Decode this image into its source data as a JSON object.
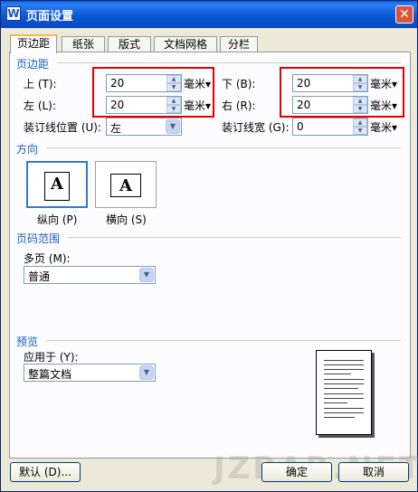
{
  "window": {
    "title": "页面设置",
    "app_icon_letter": "W",
    "close_glyph": "✕"
  },
  "tabs": [
    {
      "label": "页边距",
      "active": true
    },
    {
      "label": "纸张",
      "active": false
    },
    {
      "label": "版式",
      "active": false
    },
    {
      "label": "文档网格",
      "active": false
    },
    {
      "label": "分栏",
      "active": false
    }
  ],
  "margins": {
    "group_label": "页边距",
    "top_label": "上 (T):",
    "top_value": "20",
    "bottom_label": "下 (B):",
    "bottom_value": "20",
    "left_label": "左 (L):",
    "left_value": "20",
    "right_label": "右 (R):",
    "right_value": "20",
    "unit": "毫米▾",
    "gutter_pos_label": "装订线位置 (U):",
    "gutter_pos_value": "左",
    "gutter_width_label": "装订线宽 (G):",
    "gutter_width_value": "0",
    "highlight_color": "#e00000"
  },
  "orientation": {
    "group_label": "方向",
    "portrait_label": "纵向 (P)",
    "landscape_label": "横向 (S)",
    "glyph": "A",
    "selected": "portrait"
  },
  "page_range": {
    "group_label": "页码范围",
    "multi_label": "多页 (M):",
    "multi_value": "普通"
  },
  "preview": {
    "group_label": "预览",
    "apply_label": "应用于 (Y):",
    "apply_value": "整篇文档"
  },
  "buttons": {
    "default": "默认 (D)...",
    "ok": "确定",
    "cancel": "取消"
  },
  "watermark": "JZBAR.NET",
  "icons": {
    "spin_up": "▲",
    "spin_down": "▼",
    "combo_arrow": "▼"
  }
}
